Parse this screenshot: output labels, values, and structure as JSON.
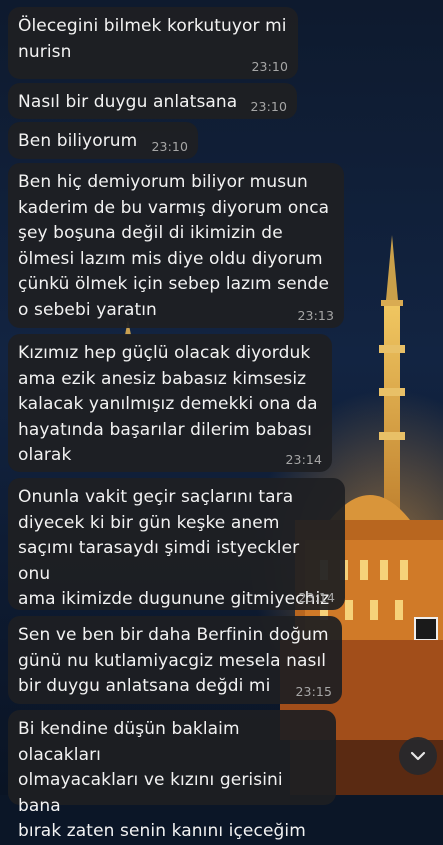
{
  "messages": [
    {
      "text": "Ölecegini bilmek korkutuyor mi\nnurisn",
      "time": "23:10"
    },
    {
      "text": "Nasıl bir duygu anlatsana",
      "time": "23:10"
    },
    {
      "text": "Ben biliyorum",
      "time": "23:10"
    },
    {
      "text": "Ben hiç demiyorum biliyor musun\nkaderim de bu varmış diyorum onca\nşey boşuna değil di ikimizin de\nölmesi lazım mis diye oldu diyorum\nçünkü ölmek için sebep lazım sende\no sebebi yaratın",
      "time": "23:13"
    },
    {
      "text": "Kızımız hep güçlü olacak diyorduk\nama ezik anesiz babasız kimsesiz\nkalacak yanılmışız demekki ona da\nhayatında başarılar dilerim babası\nolarak",
      "time": "23:14"
    },
    {
      "text": "Onunla vakit geçir saçlarını tara\ndiyecek ki bir gün keşke anem\nsaçımı tarasaydı şimdi istyeckler onu\nama ikimizde dugunune gitmiyechiz",
      "time": "23:14"
    },
    {
      "text": "Sen ve ben bir daha Berfinin doğum\ngünü nu kutlamiyacgiz mesela nasıl\nbir duygu anlatsana değdi mi",
      "time": "23:15"
    },
    {
      "text": "Bi kendine düşün baklaim olacakları\nolmayacakları ve kızını gerisini bana\nbırak zaten senin kanını içeceğim",
      "time": ""
    }
  ],
  "scroll_button_icon": "chevron-down-icon"
}
